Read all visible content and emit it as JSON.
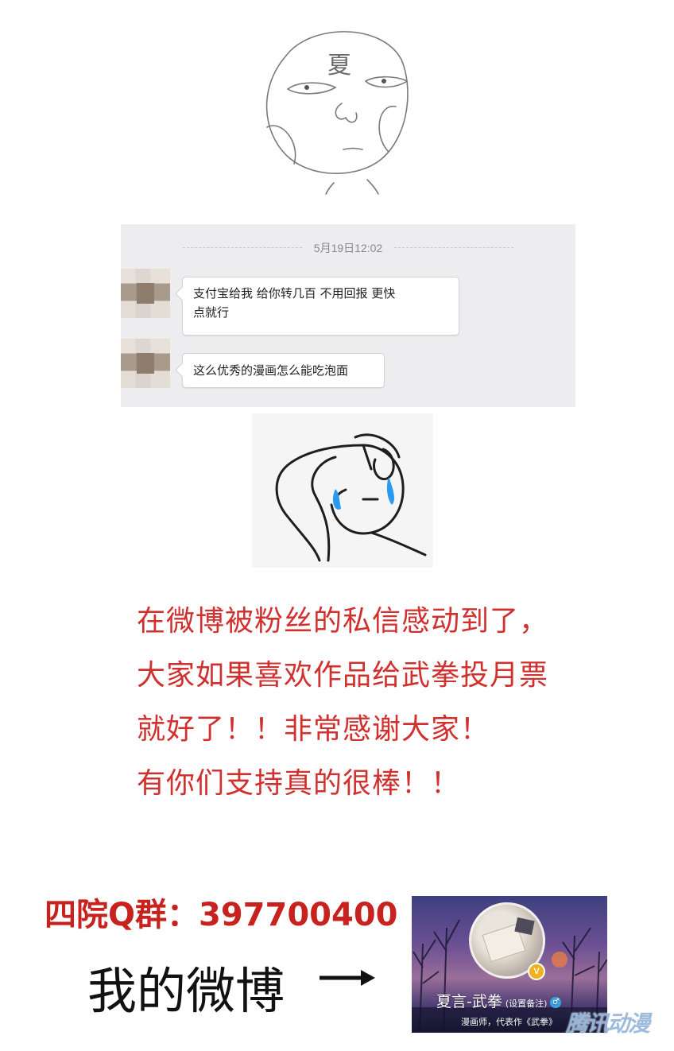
{
  "face_doodle": {
    "forehead_char": "夏"
  },
  "chat": {
    "timestamp": "5月19日12:02",
    "messages": [
      {
        "line1": "支付宝给我  给你转几百  不用回报  更快",
        "line2": "点就行"
      },
      {
        "line1": "这么优秀的漫画怎么能吃泡面"
      }
    ]
  },
  "message": {
    "lines": [
      "在微博被粉丝的私信感动到了，",
      "大家如果喜欢作品给武拳投月票",
      "就好了！！非常感谢大家！",
      "有你们支持真的很棒！！"
    ]
  },
  "qq_group": "四院Q群：397700400",
  "weibo_label": "我的微博",
  "weibo_card": {
    "name": "夏言-武拳",
    "remark": "(设置备注)",
    "verified_mark": "V",
    "gender_mark": "♂",
    "description": "漫画师，代表作《武拳》"
  },
  "watermark": "腾讯动漫",
  "colors": {
    "message_red": "#d0302e",
    "qq_red": "#c8221f",
    "chat_bg": "#ededf0"
  }
}
